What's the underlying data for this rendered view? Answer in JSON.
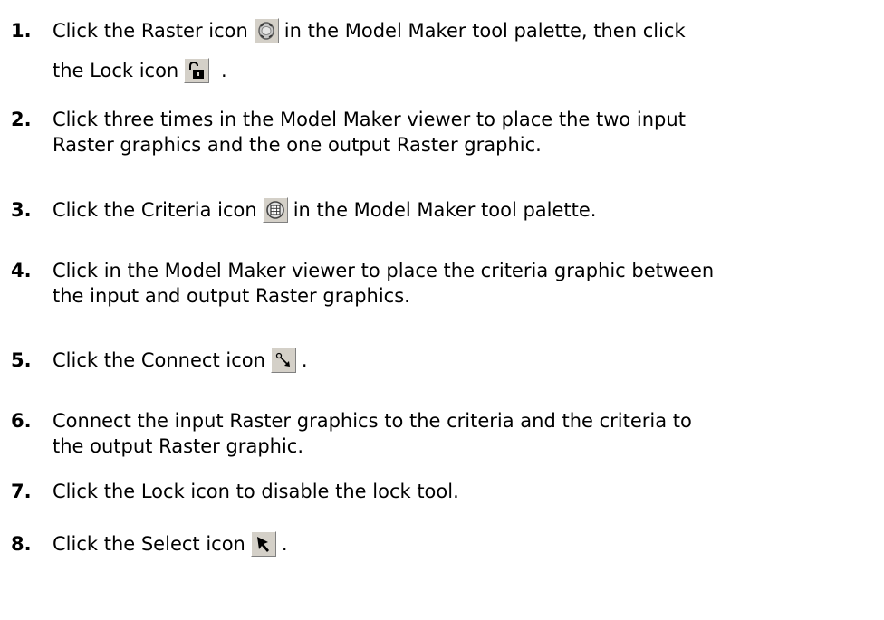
{
  "steps": [
    {
      "number": "1.",
      "before": "Click the Raster icon",
      "icon": "raster-icon",
      "after": "in the Model Maker tool palette, then click",
      "line2_before": "the Lock icon",
      "icon2": "lock-icon",
      "line2_after": "."
    },
    {
      "number": "2.",
      "line1": "Click three times in the Model Maker viewer to place the two input",
      "line2": "Raster graphics and the one output Raster graphic."
    },
    {
      "number": "3.",
      "before": "Click the Criteria icon",
      "icon": "criteria-icon",
      "after": "in the Model Maker tool palette."
    },
    {
      "number": "4.",
      "line1": "Click in the Model Maker viewer to place the criteria graphic between",
      "line2": "the input and output Raster graphics."
    },
    {
      "number": "5.",
      "before": "Click the Connect icon",
      "icon": "connect-icon",
      "after": "."
    },
    {
      "number": "6.",
      "line1": "Connect the input Raster graphics to the criteria and the criteria to",
      "line2": "the output Raster graphic."
    },
    {
      "number": "7.",
      "line1": "Click the Lock icon to disable the lock tool."
    },
    {
      "number": "8.",
      "before": "Click the Select icon",
      "icon": "select-arrow-icon",
      "after": "."
    }
  ]
}
